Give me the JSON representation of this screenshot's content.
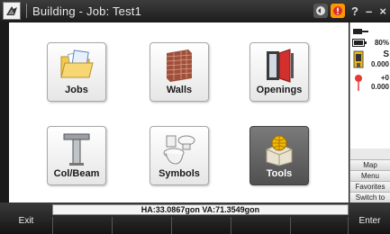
{
  "titlebar": {
    "title": "Building - Job: Test1",
    "window_buttons": [
      "?",
      "–",
      "×"
    ]
  },
  "tiles": [
    {
      "label": "Jobs",
      "icon": "folder-icon"
    },
    {
      "label": "Walls",
      "icon": "brick-wall-icon"
    },
    {
      "label": "Openings",
      "icon": "door-opening-icon"
    },
    {
      "label": "Col/Beam",
      "icon": "column-beam-icon"
    },
    {
      "label": "Symbols",
      "icon": "toilet-sink-icon"
    },
    {
      "label": "Tools",
      "icon": "toolbox-globe-icon"
    }
  ],
  "status_panel": {
    "battery": "80%",
    "s_label": "S",
    "s_value": "0.000",
    "offset_label": "+0",
    "offset_value": "0.000"
  },
  "side_menu": [
    "Map",
    "Menu",
    "Favorites",
    "Switch to"
  ],
  "angles": "HA:33.0867gon  VA:71.3549gon",
  "bottom": {
    "exit": "Exit",
    "enter": "Enter"
  },
  "colors": {
    "accent": "#ff9800",
    "titlebar": "#2a2a2a",
    "active_tile": "#606060"
  }
}
